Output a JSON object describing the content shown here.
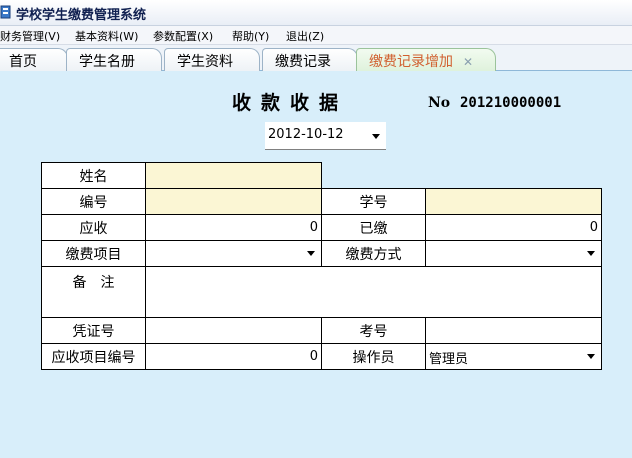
{
  "window": {
    "title": "学校学生缴费管理系统"
  },
  "menu": [
    {
      "label": "财务管理(V)"
    },
    {
      "label": "基本资料(W)"
    },
    {
      "label": "参数配置(X)"
    },
    {
      "label": "帮助(Y)"
    },
    {
      "label": "退出(Z)"
    }
  ],
  "tabs": [
    {
      "label": "首页"
    },
    {
      "label": "学生名册"
    },
    {
      "label": "学生资料"
    },
    {
      "label": "缴费记录"
    },
    {
      "label": "缴费记录增加",
      "close": "✕"
    }
  ],
  "receipt": {
    "title": "收款收据",
    "no_label": "No",
    "no_value": "201210000001",
    "date": "2012-10-12"
  },
  "form": {
    "name_label": "姓名",
    "id_label": "编号",
    "student_no_label": "学号",
    "receivable_label": "应收",
    "receivable_value": "0",
    "paid_label": "已缴",
    "paid_value": "0",
    "fee_item_label": "缴费项目",
    "pay_method_label": "缴费方式",
    "remark_label": "备　注",
    "voucher_label": "凭证号",
    "exam_no_label": "考号",
    "item_code_label": "应收项目编号",
    "item_code_value": "0",
    "operator_label": "操作员",
    "operator_value": "管理员"
  },
  "colors": {
    "background": "#d8eefa",
    "field_highlight": "#fbf6d4",
    "active_tab_text": "#d16030"
  }
}
